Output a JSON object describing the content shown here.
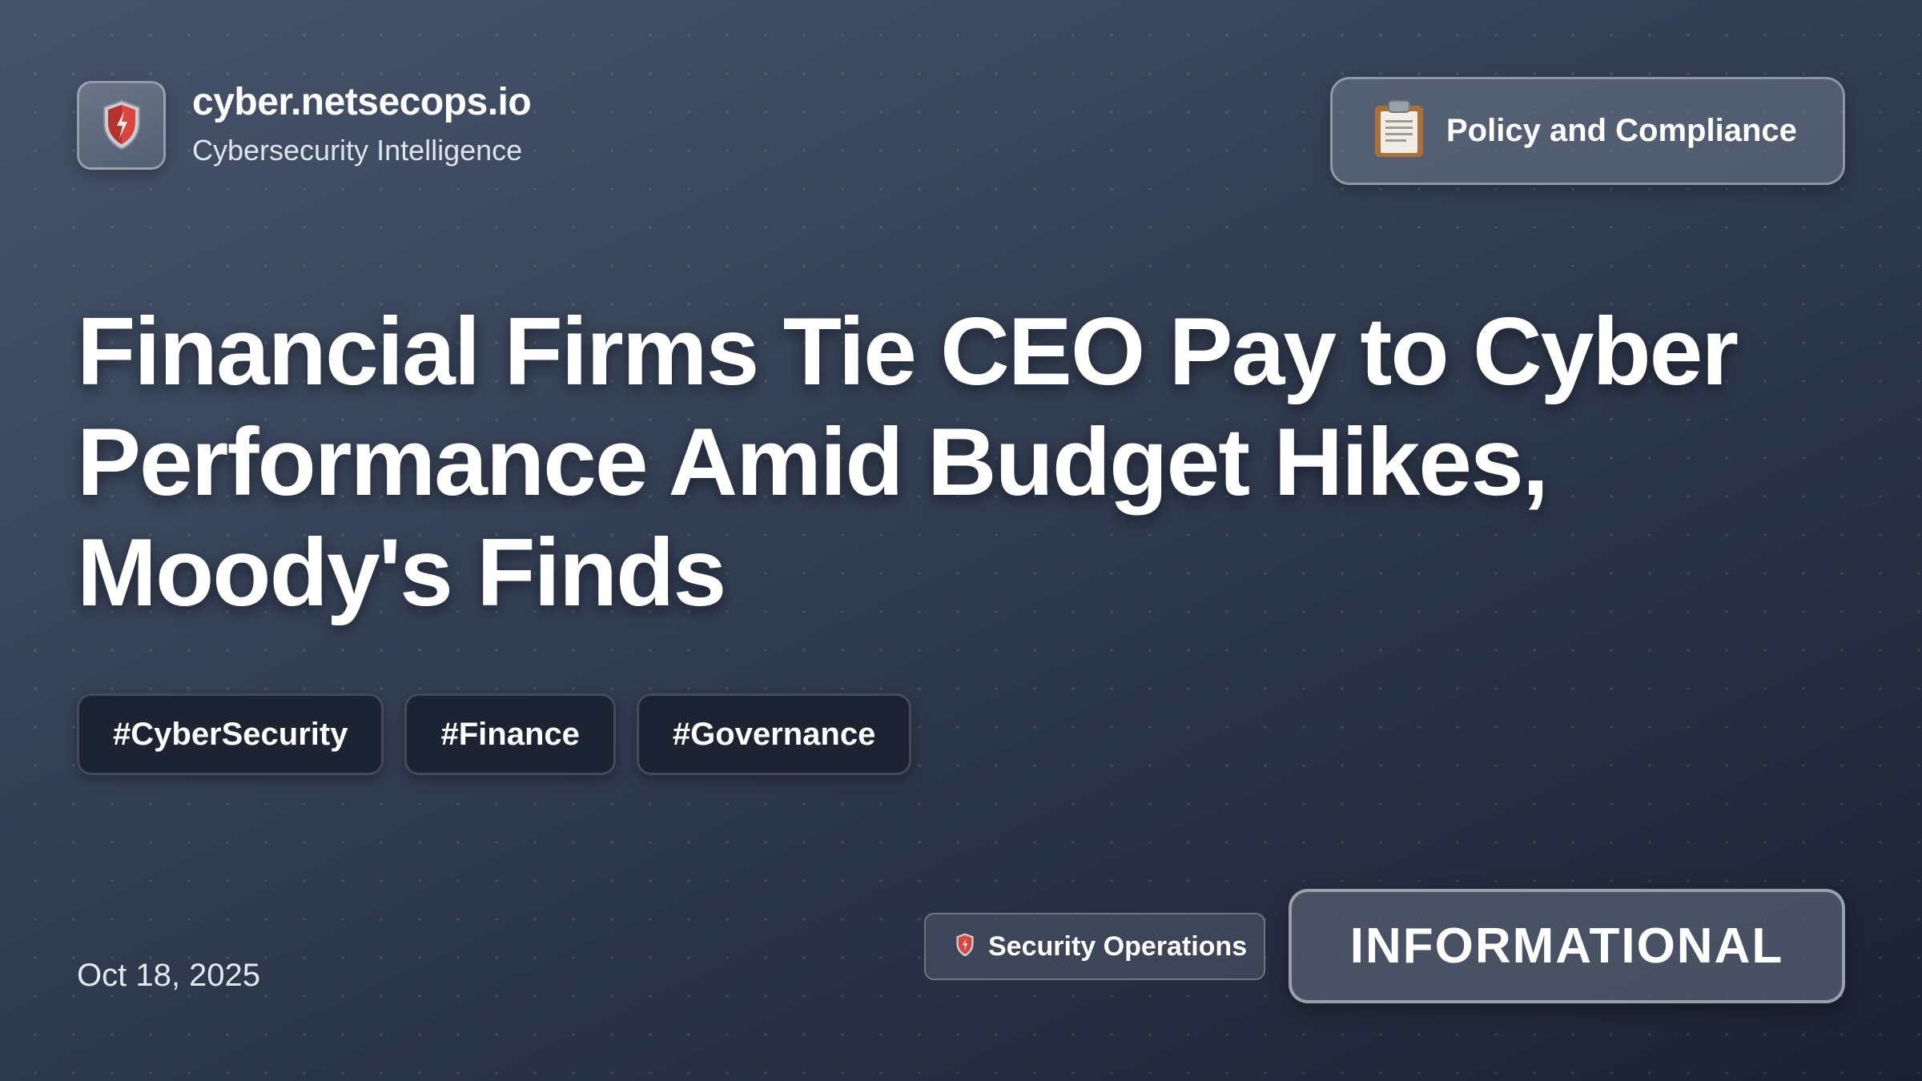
{
  "brand": {
    "icon": "shield-icon",
    "domain": "cyber.netsecops.io",
    "subtitle": "Cybersecurity Intelligence"
  },
  "category": {
    "icon": "clipboard-icon",
    "label": "Policy and Compliance"
  },
  "headline": "Financial Firms Tie CEO Pay to Cyber Performance Amid Budget Hikes, Moody's Finds",
  "tags": [
    "#CyberSecurity",
    "#Finance",
    "#Governance"
  ],
  "date": "Oct 18, 2025",
  "source": {
    "icon": "shield-icon",
    "label": "Security Operations"
  },
  "severity": "INFORMATIONAL",
  "colors": {
    "background_top": "#46536a",
    "background_bottom": "#1a2133",
    "tag_background": "#1c2333",
    "shield_red": "#d9463f"
  }
}
